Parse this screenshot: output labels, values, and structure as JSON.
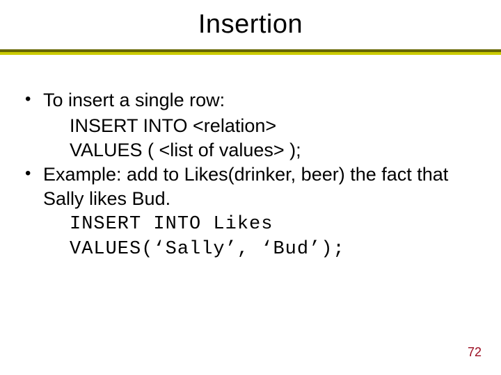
{
  "title": "Insertion",
  "bullets": [
    {
      "text": "To insert a single row:",
      "code": [
        "INSERT INTO <relation>",
        "VALUES ( <list of values> );"
      ]
    },
    {
      "text": "Example: add to Likes(drinker, beer) the fact that Sally likes Bud.",
      "code": [
        "INSERT INTO Likes",
        "VALUES(‘Sally’, ‘Bud’);"
      ]
    }
  ],
  "page_number": "72"
}
